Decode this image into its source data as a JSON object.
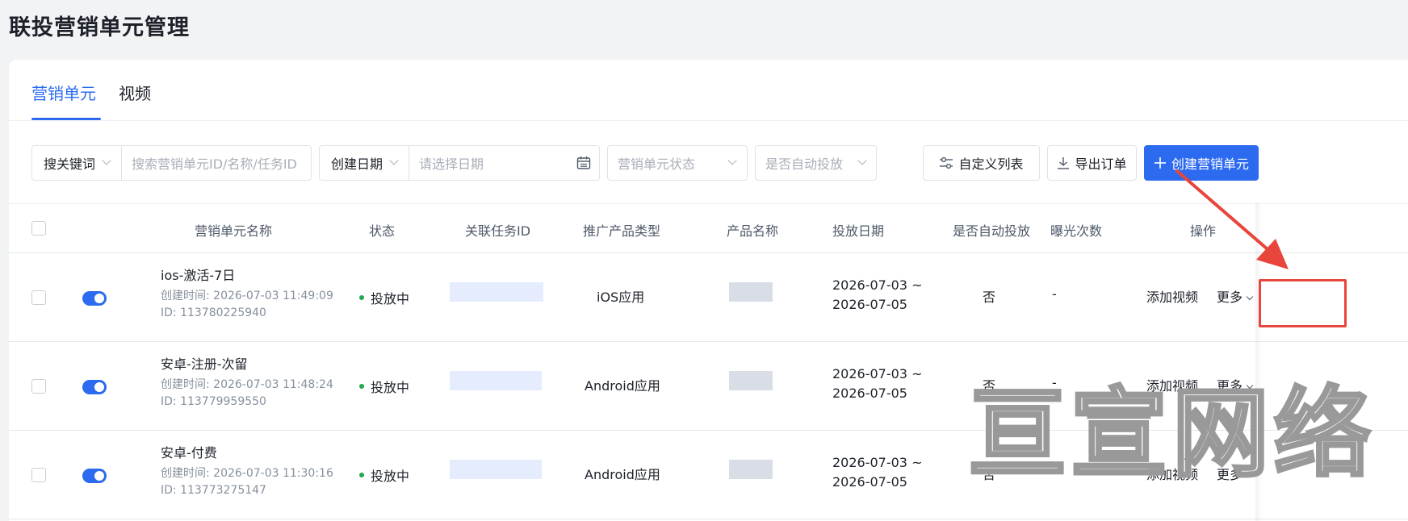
{
  "page": {
    "title": "联投营销单元管理"
  },
  "tabs": [
    {
      "label": "营销单元"
    },
    {
      "label": "视频"
    }
  ],
  "filters": {
    "keyword_type": "搜关键词",
    "keyword_placeholder": "搜索营销单元ID/名称/任务ID",
    "date_type": "创建日期",
    "date_placeholder": "请选择日期",
    "status_placeholder": "营销单元状态",
    "auto_placeholder": "是否自动投放"
  },
  "toolbar": {
    "custom_columns": "自定义列表",
    "export": "导出订单",
    "create": "创建营销单元"
  },
  "table": {
    "columns": [
      "营销单元名称",
      "状态",
      "关联任务ID",
      "推广产品类型",
      "产品名称",
      "投放日期",
      "是否自动投放",
      "曝光次数",
      "操作"
    ],
    "rows": [
      {
        "name": "ios-激活-7日",
        "created": "创建时间: 2026-07-03 11:49:09",
        "id": "ID: 113780225940",
        "status": "投放中",
        "product_type": "iOS应用",
        "date_start": "2026-07-03 ~",
        "date_end": "2026-07-05",
        "auto": "否",
        "exposure": "-",
        "action": "添加视频",
        "more": "更多"
      },
      {
        "name": "安卓-注册-次留",
        "created": "创建时间: 2026-07-03 11:48:24",
        "id": "ID: 113779959550",
        "status": "投放中",
        "product_type": "Android应用",
        "date_start": "2026-07-03 ~",
        "date_end": "2026-07-05",
        "auto": "否",
        "exposure": "-",
        "action": "添加视频",
        "more": "更多"
      },
      {
        "name": "安卓-付费",
        "created": "创建时间: 2026-07-03 11:30:16",
        "id": "ID: 113773275147",
        "status": "投放中",
        "product_type": "Android应用",
        "date_start": "2026-07-03 ~",
        "date_end": "2026-07-05",
        "auto": "否",
        "exposure": "-",
        "action": "添加视频",
        "more": "更多"
      }
    ]
  },
  "watermark": "亘宣网络",
  "colors": {
    "accent": "#2c6af0",
    "highlight": "#e8453c",
    "status_running": "#22a94f"
  }
}
